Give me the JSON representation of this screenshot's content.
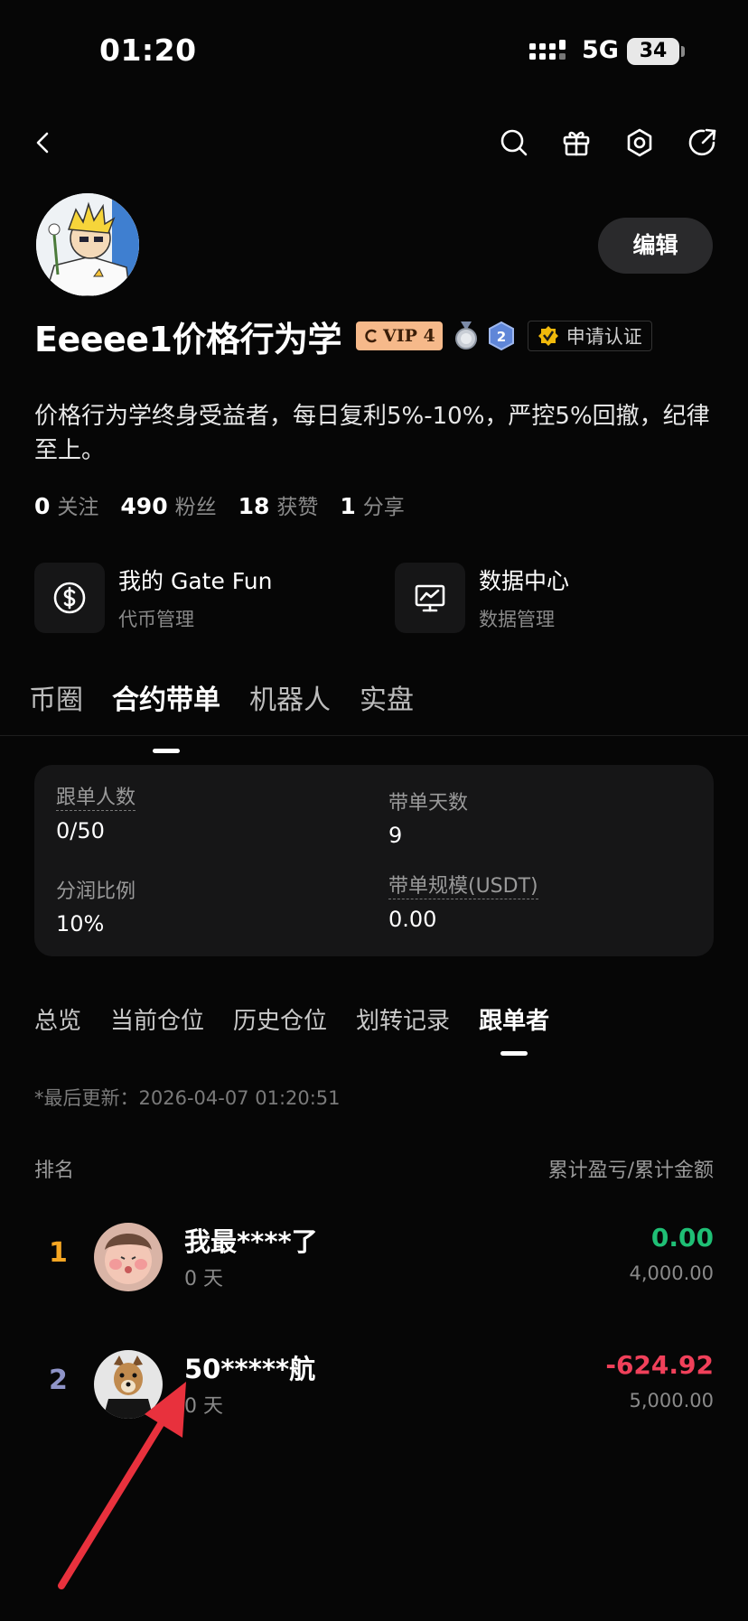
{
  "status_bar": {
    "time": "01:20",
    "network": "5G",
    "battery": "34"
  },
  "profile": {
    "name": "Eeeee1价格行为学",
    "vip": "VIP 4",
    "level_badge": "2",
    "verify_label": "申请认证",
    "edit_label": "编辑",
    "bio": "价格行为学终身受益者，每日复利5%-10%，严控5%回撤，纪律至上。",
    "stats": [
      {
        "value": "0",
        "label": "关注"
      },
      {
        "value": "490",
        "label": "粉丝"
      },
      {
        "value": "18",
        "label": "获赞"
      },
      {
        "value": "1",
        "label": "分享"
      }
    ]
  },
  "tools": [
    {
      "title": "我的 Gate Fun",
      "subtitle": "代币管理",
      "icon": "dollar-icon"
    },
    {
      "title": "数据中心",
      "subtitle": "数据管理",
      "icon": "chart-monitor-icon"
    }
  ],
  "main_tabs": [
    {
      "label": "币圈",
      "active": false
    },
    {
      "label": "合约带单",
      "active": true
    },
    {
      "label": "机器人",
      "active": false
    },
    {
      "label": "实盘",
      "active": false
    }
  ],
  "summary": {
    "followers_label": "跟单人数",
    "followers_value": "0/50",
    "days_label": "带单天数",
    "days_value": "9",
    "share_label": "分润比例",
    "share_value": "10%",
    "scale_label": "带单规模(USDT)",
    "scale_value": "0.00"
  },
  "sub_tabs": [
    {
      "label": "总览",
      "active": false
    },
    {
      "label": "当前仓位",
      "active": false
    },
    {
      "label": "历史仓位",
      "active": false
    },
    {
      "label": "划转记录",
      "active": false
    },
    {
      "label": "跟单者",
      "active": true
    }
  ],
  "last_updated": "*最后更新：2026-04-07 01:20:51",
  "list_header": {
    "left": "排名",
    "right": "累计盈亏/累计金额"
  },
  "followers": [
    {
      "rank": "1",
      "name": "我最****了",
      "days": "0 天",
      "pnl": "0.00",
      "total": "4,000.00",
      "rank_color": "#f5a623",
      "pnl_color": "#1fbf75"
    },
    {
      "rank": "2",
      "name": "50*****航",
      "days": "0 天",
      "pnl": "-624.92",
      "total": "5,000.00",
      "rank_color": "#8f94c8",
      "pnl_color": "#f0405a"
    }
  ]
}
